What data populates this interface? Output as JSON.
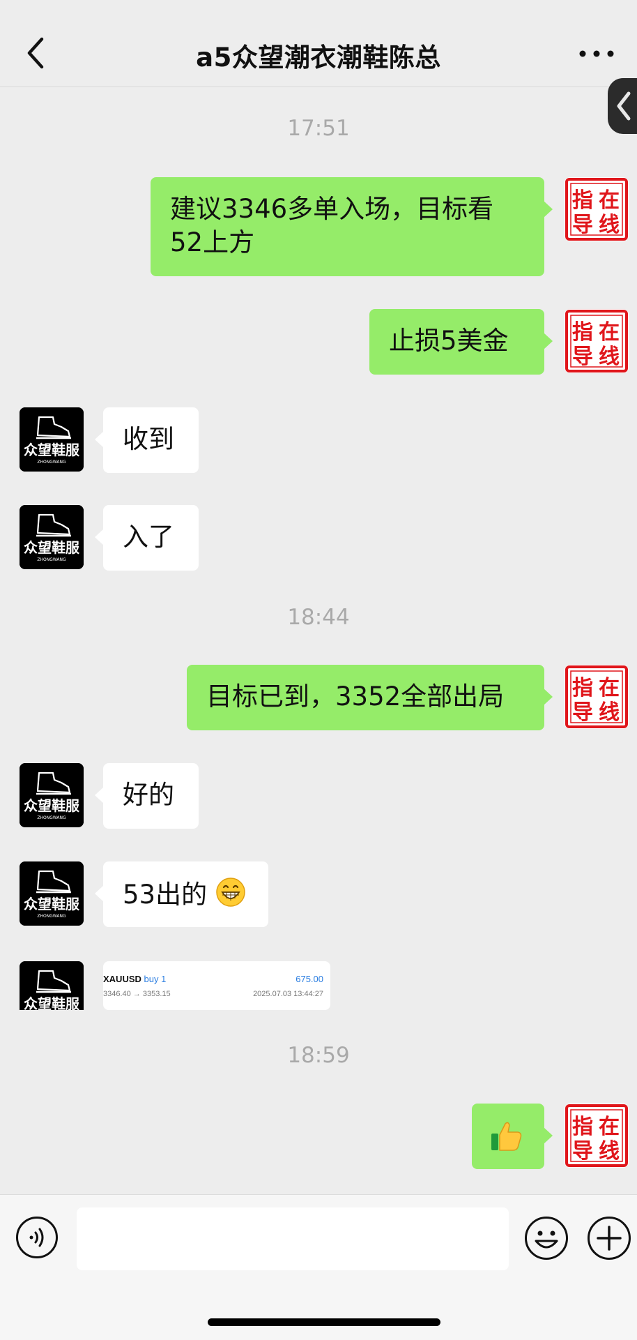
{
  "header": {
    "title": "a5众望潮衣潮鞋陈总"
  },
  "avatars": {
    "me_stamp_chars": [
      "指",
      "在",
      "导",
      "线"
    ],
    "them_logo_text": "众望鞋服",
    "them_logo_subtext": "ZHONGWANG"
  },
  "timestamps": [
    "17:51",
    "18:44",
    "18:59"
  ],
  "messages": [
    {
      "from": "me",
      "text_line1": "建议3346多单入场，目标看",
      "text_line2": "52上方"
    },
    {
      "from": "me",
      "text": "止损5美金"
    },
    {
      "from": "them",
      "text": "收到"
    },
    {
      "from": "them",
      "text": "入了"
    },
    {
      "from": "me",
      "text": "目标已到，3352全部出局"
    },
    {
      "from": "them",
      "text": "好的"
    },
    {
      "from": "them",
      "text": "53出的",
      "emoji": "grinning-face"
    },
    {
      "from": "them",
      "type": "trade-screenshot"
    },
    {
      "from": "me",
      "emoji": "thumbs-up"
    }
  ],
  "trade_card": {
    "symbol": "XAUUSD",
    "side": "buy 1",
    "profit": "675.00",
    "prices": "3346.40 → 3353.15",
    "datetime": "2025.07.03 13:44:27"
  },
  "colors": {
    "background": "#ededed",
    "my_bubble": "#95ec69",
    "their_bubble": "#ffffff",
    "stamp_red": "#e0161b"
  },
  "icons": {
    "back": "chevron-left-icon",
    "more": "ellipsis-icon",
    "voice": "voice-icon",
    "emoji": "smiley-icon",
    "plus": "plus-icon"
  }
}
